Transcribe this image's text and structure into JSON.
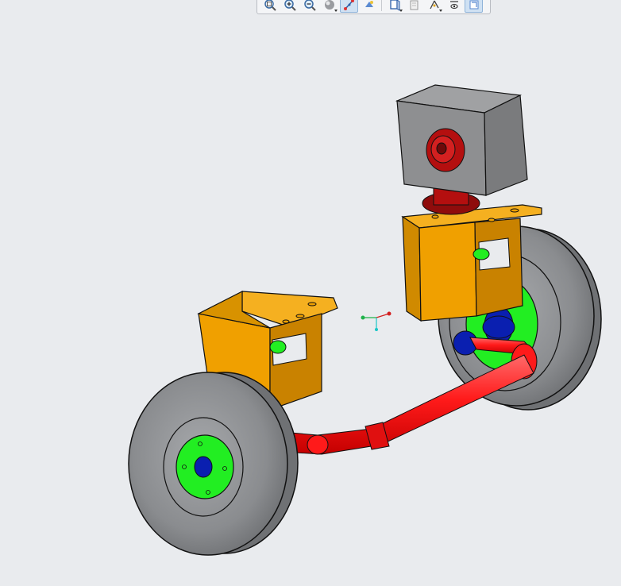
{
  "toolbar": {
    "buttons": [
      {
        "icon": "refit-icon"
      },
      {
        "icon": "zoom-in-icon"
      },
      {
        "icon": "zoom-out-icon"
      },
      {
        "icon": "display-style-icon"
      },
      {
        "icon": "saved-orientations-icon"
      },
      {
        "icon": "view-manager-icon"
      },
      {
        "icon": "perspective-view-icon"
      },
      {
        "icon": "section-icon"
      },
      {
        "icon": "datum-display-icon"
      },
      {
        "icon": "annotation-display-icon"
      },
      {
        "icon": "spin-center-icon"
      }
    ],
    "active_buttons": [
      "view-manager-icon",
      "spin-center-icon"
    ]
  },
  "viewport": {
    "background": "#e9ebee",
    "colors": {
      "bracket": "#f0a000",
      "bracket_dark": "#c87f00",
      "tie_rod": "#ff1a1a",
      "hub": "#22ee22",
      "ball_joint": "#0a1fb0",
      "tire": "#8a8c8f",
      "motor_box": "#8e8f91",
      "shaft": "#b40f0f"
    },
    "spin_center_icon": "spin-center-axes-icon"
  }
}
